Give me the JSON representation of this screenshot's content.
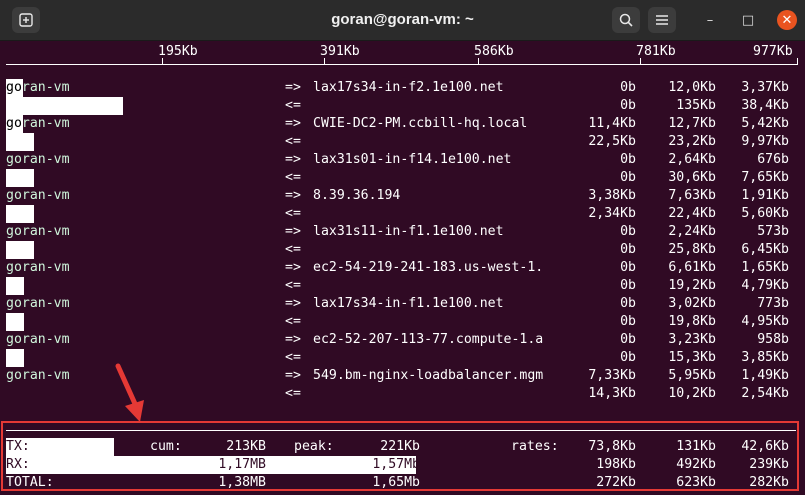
{
  "titlebar": {
    "title": "goran@goran-vm: ~",
    "new_tab_icon": "new-tab-icon",
    "search_icon": "search-icon",
    "menu_icon": "hamburger-menu-icon",
    "minimize": "–",
    "maximize": "□",
    "close": "✕"
  },
  "scale": {
    "labels": [
      "195Kb",
      "391Kb",
      "586Kb",
      "781Kb",
      "977Kb"
    ]
  },
  "connections": [
    {
      "host": "goran-vm",
      "dir_out": "=>",
      "dir_in": "<=",
      "remote": "lax17s34-in-f2.1e100.net",
      "out": [
        "0b",
        "12,0Kb",
        "3,37Kb"
      ],
      "in": [
        "0b",
        "135Kb",
        "38,4Kb"
      ]
    },
    {
      "host": "goran-vm",
      "dir_out": "=>",
      "dir_in": "<=",
      "remote": "CWIE-DC2-PM.ccbill-hq.local",
      "out": [
        "11,4Kb",
        "12,7Kb",
        "5,42Kb"
      ],
      "in": [
        "22,5Kb",
        "23,2Kb",
        "9,97Kb"
      ]
    },
    {
      "host": "goran-vm",
      "dir_out": "=>",
      "dir_in": "<=",
      "remote": "lax31s01-in-f14.1e100.net",
      "out": [
        "0b",
        "2,64Kb",
        "676b"
      ],
      "in": [
        "0b",
        "30,6Kb",
        "7,65Kb"
      ]
    },
    {
      "host": "goran-vm",
      "dir_out": "=>",
      "dir_in": "<=",
      "remote": "8.39.36.194",
      "out": [
        "3,38Kb",
        "7,63Kb",
        "1,91Kb"
      ],
      "in": [
        "2,34Kb",
        "22,4Kb",
        "5,60Kb"
      ]
    },
    {
      "host": "goran-vm",
      "dir_out": "=>",
      "dir_in": "<=",
      "remote": "lax31s11-in-f1.1e100.net",
      "out": [
        "0b",
        "2,24Kb",
        "573b"
      ],
      "in": [
        "0b",
        "25,8Kb",
        "6,45Kb"
      ]
    },
    {
      "host": "goran-vm",
      "dir_out": "=>",
      "dir_in": "<=",
      "remote": "ec2-54-219-241-183.us-west-1.",
      "out": [
        "0b",
        "6,61Kb",
        "1,65Kb"
      ],
      "in": [
        "0b",
        "19,2Kb",
        "4,79Kb"
      ]
    },
    {
      "host": "goran-vm",
      "dir_out": "=>",
      "dir_in": "<=",
      "remote": "lax17s34-in-f1.1e100.net",
      "out": [
        "0b",
        "3,02Kb",
        "773b"
      ],
      "in": [
        "0b",
        "19,8Kb",
        "4,95Kb"
      ]
    },
    {
      "host": "goran-vm",
      "dir_out": "=>",
      "dir_in": "<=",
      "remote": "ec2-52-207-113-77.compute-1.a",
      "out": [
        "0b",
        "3,23Kb",
        "958b"
      ],
      "in": [
        "0b",
        "15,3Kb",
        "3,85Kb"
      ]
    },
    {
      "host": "goran-vm",
      "dir_out": "=>",
      "dir_in": "<=",
      "remote": "549.bm-nginx-loadbalancer.mgm",
      "out": [
        "7,33Kb",
        "5,95Kb",
        "1,49Kb"
      ],
      "in": [
        "14,3Kb",
        "10,2Kb",
        "2,54Kb"
      ]
    }
  ],
  "totals": {
    "tx": {
      "label": "TX:",
      "cum_label": "cum:",
      "cum": "213KB",
      "peak_label": "peak:",
      "peak": "221Kb",
      "rates_label": "rates:",
      "rates": [
        "73,8Kb",
        "131Kb",
        "42,6Kb"
      ]
    },
    "rx": {
      "label": "RX:",
      "cum": "1,17MB",
      "peak": "1,57Mb",
      "rates": [
        "198Kb",
        "492Kb",
        "239Kb"
      ]
    },
    "total": {
      "label": "TOTAL:",
      "cum": "1,38MB",
      "peak": "1,65Mb",
      "rates": [
        "272Kb",
        "623Kb",
        "282Kb"
      ]
    }
  },
  "annotation": {
    "arrow_color": "#e53935",
    "frame_color": "#e53935"
  },
  "colors": {
    "terminal_bg": "#300a24",
    "titlebar_bg": "#2b2b2b",
    "close_button": "#e95420"
  }
}
